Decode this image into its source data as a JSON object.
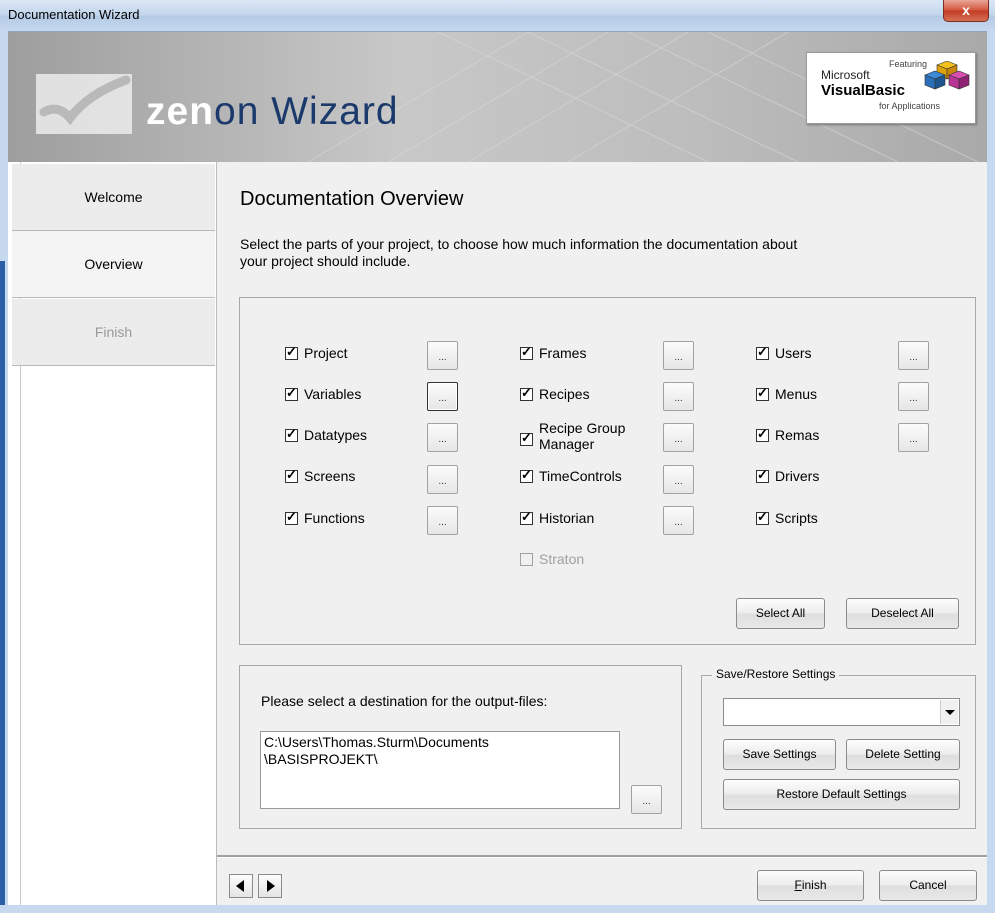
{
  "window": {
    "title": "Documentation Wizard",
    "close_glyph": "x"
  },
  "banner": {
    "logo_text_1": "zen",
    "logo_text_2": "on",
    "logo_text_3": "Wizard",
    "badge": {
      "featuring": "Featuring",
      "microsoft": "Microsoft",
      "visual_basic": "VisualBasic",
      "for_applications": "for Applications"
    }
  },
  "nav": {
    "items": [
      {
        "label": "Welcome",
        "state": "normal"
      },
      {
        "label": "Overview",
        "state": "active"
      },
      {
        "label": "Finish",
        "state": "disabled"
      }
    ]
  },
  "page": {
    "heading": "Documentation Overview",
    "description": "Select the parts of your project, to choose how much information the documentation about your project should include."
  },
  "options": {
    "col1": [
      {
        "label": "Project",
        "checked": true
      },
      {
        "label": "Variables",
        "checked": true
      },
      {
        "label": "Datatypes",
        "checked": true
      },
      {
        "label": "Screens",
        "checked": true
      },
      {
        "label": "Functions",
        "checked": true
      }
    ],
    "col2": [
      {
        "label": "Frames",
        "checked": true
      },
      {
        "label": "Recipes",
        "checked": true
      },
      {
        "label": "Recipe Group Manager",
        "checked": true
      },
      {
        "label": "TimeControls",
        "checked": true
      },
      {
        "label": "Historian",
        "checked": true
      },
      {
        "label": "Straton",
        "checked": false,
        "disabled": true
      }
    ],
    "col3": [
      {
        "label": "Users",
        "checked": true
      },
      {
        "label": "Menus",
        "checked": true
      },
      {
        "label": "Remas",
        "checked": true
      },
      {
        "label": "Drivers",
        "checked": true
      },
      {
        "label": "Scripts",
        "checked": true
      }
    ],
    "dots_label": "...",
    "select_all": "Select All",
    "deselect_all": "Deselect All"
  },
  "output": {
    "prompt": "Please select a destination for the output-files:",
    "path_line1": "C:\\Users\\Thomas.Sturm\\Documents",
    "path_line2": "\\BASISPROJEKT\\",
    "browse": "..."
  },
  "settings": {
    "legend": "Save/Restore Settings",
    "selected": "",
    "save": "Save Settings",
    "delete": "Delete Setting",
    "restore": "Restore Default Settings"
  },
  "footer": {
    "finish": "Finish",
    "cancel": "Cancel"
  }
}
